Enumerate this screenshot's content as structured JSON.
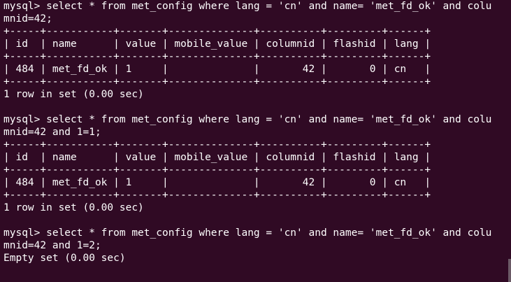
{
  "terminal": {
    "background": "#300a24",
    "foreground": "#ffffff",
    "lines": [
      "mysql> select * from met_config where lang = 'cn' and name= 'met_fd_ok' and colu",
      "mnid=42;",
      "+-----+-----------+-------+--------------+----------+---------+------+",
      "| id  | name      | value | mobile_value | columnid | flashid | lang |",
      "+-----+-----------+-------+--------------+----------+---------+------+",
      "| 484 | met_fd_ok | 1     |              |       42 |       0 | cn   |",
      "+-----+-----------+-------+--------------+----------+---------+------+",
      "1 row in set (0.00 sec)",
      "",
      "mysql> select * from met_config where lang = 'cn' and name= 'met_fd_ok' and colu",
      "mnid=42 and 1=1;",
      "+-----+-----------+-------+--------------+----------+---------+------+",
      "| id  | name      | value | mobile_value | columnid | flashid | lang |",
      "+-----+-----------+-------+--------------+----------+---------+------+",
      "| 484 | met_fd_ok | 1     |              |       42 |       0 | cn   |",
      "+-----+-----------+-------+--------------+----------+---------+------+",
      "1 row in set (0.00 sec)",
      "",
      "mysql> select * from met_config where lang = 'cn' and name= 'met_fd_ok' and colu",
      "mnid=42 and 1=2;",
      "Empty set (0.00 sec)"
    ]
  }
}
